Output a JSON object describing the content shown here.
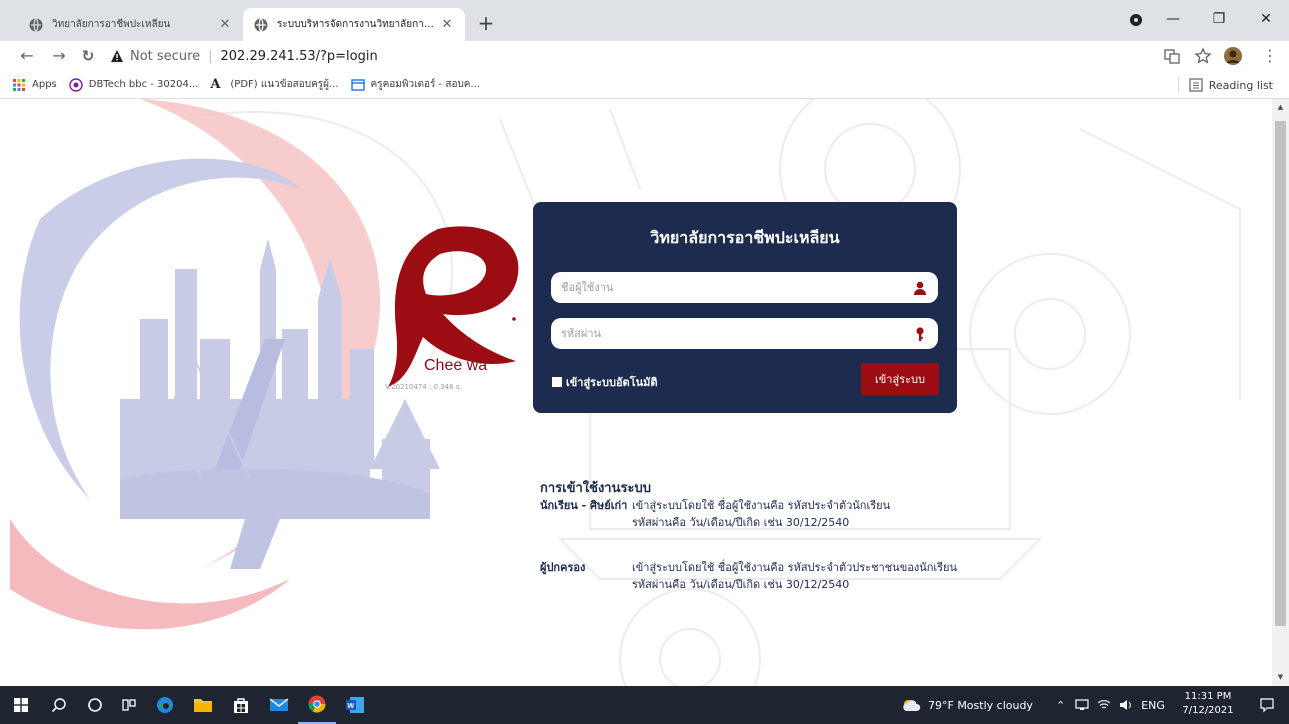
{
  "browser": {
    "tabs": [
      {
        "label": "วิทยาลัยการอาชีพปะเหลียน",
        "active": false
      },
      {
        "label": "ระบบบริหารจัดการงานวิทยาลัยการอาชี",
        "active": true
      }
    ],
    "address": {
      "security_label": "Not secure",
      "url": "202.29.241.53/?p=login"
    },
    "bookmarks": [
      {
        "label": "Apps",
        "icon": "apps-grid-icon"
      },
      {
        "label": "DBTech bbc - 30204...",
        "icon": "dbtech-icon"
      },
      {
        "label": "(PDF) แนวข้อสอบครูผู้...",
        "icon": "academia-icon"
      },
      {
        "label": "ครูคอมพิวเตอร์ - สอบค...",
        "icon": "site-icon"
      }
    ],
    "reading_list": "Reading list"
  },
  "page": {
    "brand": "Chee wa",
    "version": "V.20210474 : 0.346 s.",
    "login": {
      "title": "วิทยาลัยการอาชีพปะเหลียน",
      "username_placeholder": "ชื่อผู้ใช้งาน",
      "password_placeholder": "รหัสผ่าน",
      "remember_label": "เข้าสู่ระบบอัตโนมัติ",
      "submit_label": "เข้าสู่ระบบ"
    },
    "info": {
      "title": "การเข้าใช้งานระบบ",
      "rows": [
        {
          "role": "นักเรียน - ศิษย์เก่า",
          "desc_1": "เข้าสู่ระบบโดยใช้ ชื่อผู้ใช้งานคือ รหัสประจำตัวนักเรียน",
          "desc_2": "รหัสผ่านคือ วัน/เดือน/ปีเกิด เช่น 30/12/2540"
        },
        {
          "role": "ผู้ปกครอง",
          "desc_1": "เข้าสู่ระบบโดยใช้ ชื่อผู้ใช้งานคือ รหัสประจำตัวประชาชนของนักเรียน",
          "desc_2": "รหัสผ่านคือ วัน/เดือน/ปีเกิด เช่น 30/12/2540"
        }
      ]
    },
    "watermark": "CHEEWA"
  },
  "taskbar": {
    "weather": "79°F  Mostly cloudy",
    "language": "ENG",
    "time": "11:31 PM",
    "date": "7/12/2021"
  },
  "colors": {
    "card": "#1c2b4e",
    "accent": "#9b0d13",
    "watermark_blue": "#c7cbe6",
    "watermark_red": "#f4b8bb"
  }
}
